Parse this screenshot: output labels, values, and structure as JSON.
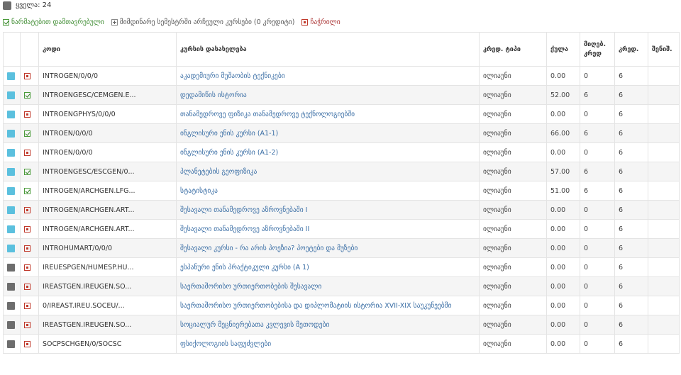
{
  "summary": {
    "total_label": "ყველა: 24"
  },
  "legend": {
    "passed": "ნარმატებით დამთავრებული",
    "current": "მიმდინარე სემესტრში არჩეული კურსები (0 კრედიტი)",
    "failed": "ჩაჭრილი"
  },
  "table": {
    "headers": {
      "code": "კოდი",
      "name": "კურსის დასახელება",
      "type": "კრედ. ტიპი",
      "score": "ქულა",
      "earned": "მიღებ. კრედ",
      "credit": "კრედ.",
      "note": "შენიშ."
    },
    "rows": [
      {
        "sel": "active",
        "status": "fail",
        "code": "INTROGEN/0/0/0",
        "name": "აკადემიური მუშაობის ტექნიკები",
        "type": "ილიაუნი",
        "score": "0.00",
        "earned": "0",
        "credit": "6",
        "note": ""
      },
      {
        "sel": "active",
        "status": "pass",
        "code": "INTROENGESC/CEMGEN.E...",
        "name": "დედამიწის ისტორია",
        "type": "ილიაუნი",
        "score": "52.00",
        "earned": "6",
        "credit": "6",
        "note": ""
      },
      {
        "sel": "active",
        "status": "fail",
        "code": "INTROENGPHYS/0/0/0",
        "name": "თანამედროვე ფიზიკა თანამედროვე ტექნოლოგიებში",
        "type": "ილიაუნი",
        "score": "0.00",
        "earned": "0",
        "credit": "6",
        "note": ""
      },
      {
        "sel": "active",
        "status": "pass",
        "code": "INTROEN/0/0/0",
        "name": "ინგლისური ენის კურსი (A1-1)",
        "type": "ილიაუნი",
        "score": "66.00",
        "earned": "6",
        "credit": "6",
        "note": ""
      },
      {
        "sel": "active",
        "status": "fail",
        "code": "INTROEN/0/0/0",
        "name": "ინგლისური ენის კურსი (A1-2)",
        "type": "ილიაუნი",
        "score": "0.00",
        "earned": "0",
        "credit": "6",
        "note": ""
      },
      {
        "sel": "active",
        "status": "pass",
        "code": "INTROENGESC/ESCGEN/0...",
        "name": "პლანეტების გეოფიზიკა",
        "type": "ილიაუნი",
        "score": "57.00",
        "earned": "6",
        "credit": "6",
        "note": ""
      },
      {
        "sel": "active",
        "status": "pass",
        "code": "INTROGEN/ARCHGEN.LFG...",
        "name": "სტატისტიკა",
        "type": "ილიაუნი",
        "score": "51.00",
        "earned": "6",
        "credit": "6",
        "note": ""
      },
      {
        "sel": "active",
        "status": "fail",
        "code": "INTROGEN/ARCHGEN.ART...",
        "name": "შესავალი თანამედროვე აზროვნებაში I",
        "type": "ილიაუნი",
        "score": "0.00",
        "earned": "0",
        "credit": "6",
        "note": ""
      },
      {
        "sel": "active",
        "status": "fail",
        "code": "INTROGEN/ARCHGEN.ART...",
        "name": "შესავალი თანამედროვე აზროვნებაში II",
        "type": "ილიაუნი",
        "score": "0.00",
        "earned": "0",
        "credit": "6",
        "note": ""
      },
      {
        "sel": "active",
        "status": "fail",
        "code": "INTROHUMART/0/0/0",
        "name": "შესავალი კურსი - რა არის პოეზია? პოეტები და მუზები",
        "type": "ილიაუნი",
        "score": "0.00",
        "earned": "0",
        "credit": "6",
        "note": ""
      },
      {
        "sel": "inactive",
        "status": "fail",
        "code": "IREUESPGEN/HUMESP.HU...",
        "name": "ესპანური ენის პრაქტიკული კურსი (A 1)",
        "type": "ილიაუნი",
        "score": "0.00",
        "earned": "0",
        "credit": "6",
        "note": ""
      },
      {
        "sel": "inactive",
        "status": "fail",
        "code": "IREASTGEN.IREUGEN.SO...",
        "name": "საერთაშორისო ურთიერთობების შესავალი",
        "type": "ილიაუნი",
        "score": "0.00",
        "earned": "0",
        "credit": "6",
        "note": ""
      },
      {
        "sel": "inactive",
        "status": "fail",
        "code": "0/IREAST.IREU.SOCEU/...",
        "name": "საერთაშორისო ურთიერთობებისა და დიპლომატიის ისტორია XVII-XIX საუკუნეებში",
        "type": "ილიაუნი",
        "score": "0.00",
        "earned": "0",
        "credit": "6",
        "note": ""
      },
      {
        "sel": "inactive",
        "status": "fail",
        "code": "IREASTGEN.IREUGEN.SO...",
        "name": "სოციალურ მეცნიერებათა კვლევის მეთოდები",
        "type": "ილიაუნი",
        "score": "0.00",
        "earned": "0",
        "credit": "6",
        "note": ""
      },
      {
        "sel": "inactive",
        "status": "fail",
        "code": "SOCPSCHGEN/0/SOCSC",
        "name": "ფსიქოლოგიის საფუძვლები",
        "type": "ილიაუნი",
        "score": "0.00",
        "earned": "0",
        "credit": "6",
        "note": ""
      }
    ]
  }
}
